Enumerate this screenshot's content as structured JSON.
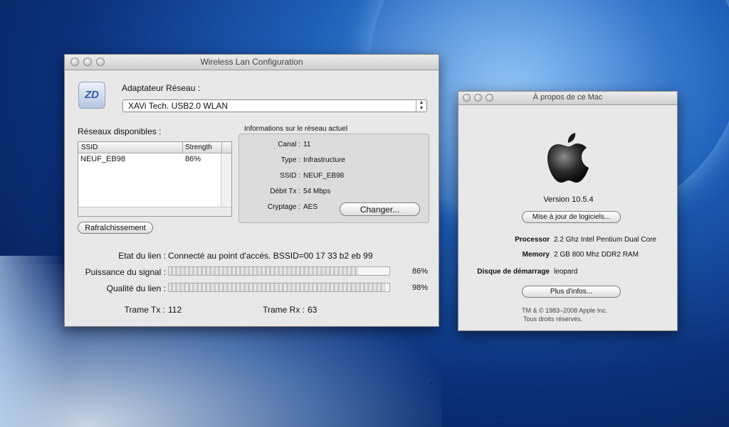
{
  "wlan": {
    "title": "Wireless Lan Configuration",
    "adapter_label": "Adaptateur Réseau :",
    "adapter_value": "XAVi Tech. USB2.0 WLAN",
    "app_icon_text": "ZD",
    "networks_label": "Réseaux disponibles :",
    "table": {
      "columns": [
        "SSID",
        "Strength"
      ],
      "rows": [
        {
          "ssid": "NEUF_EB98",
          "strength": "86%"
        }
      ]
    },
    "refresh_button": "Rafraîchissement",
    "info_title": "Informations sur le réseau actuel",
    "info": {
      "canal_label": "Canal :",
      "canal_value": "11",
      "type_label": "Type :",
      "type_value": "Infrastructure",
      "ssid_label": "SSID :",
      "ssid_value": "NEUF_EB98",
      "debit_label": "Débit Tx :",
      "debit_value": "54 Mbps",
      "cryptage_label": "Cryptage :",
      "cryptage_value": "AES"
    },
    "change_button": "Changer...",
    "link_state_label": "Etat du lien :",
    "link_state_value": "Connecté au point d'accés. BSSID=00 17 33 b2 eb 99",
    "signal_label": "Puissance du signal :",
    "signal_value": "86%",
    "signal_fraction": 0.86,
    "quality_label": "Qualité du lien :",
    "quality_value": "98%",
    "quality_fraction": 0.98,
    "tx_label": "Trame Tx :",
    "tx_value": "112",
    "rx_label": "Trame Rx :",
    "rx_value": "63"
  },
  "about": {
    "title": "À propos de ce Mac",
    "version": "Version 10.5.4",
    "update_button": "Mise à jour de logiciels...",
    "processor_label": "Processor",
    "processor_value": "2.2 Ghz Intel Pentium Dual Core",
    "memory_label": "Memory",
    "memory_value": "2 GB 800 Mhz DDR2  RAM",
    "disk_label": "Disque de démarrage",
    "disk_value": "leopard",
    "more_button": "Plus d'infos...",
    "copyright_line1": "TM & © 1983–2008 Apple Inc.",
    "copyright_line2": "Tous droits réservés."
  },
  "colors": {
    "window_bg": "#e8e8e8",
    "desktop_blue": "#1f5fb8"
  }
}
